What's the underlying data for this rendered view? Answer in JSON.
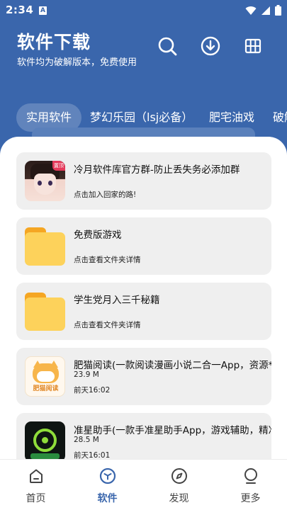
{
  "status": {
    "time": "2:34",
    "notif_letter": "A"
  },
  "header": {
    "title": "软件下载",
    "subtitle": "软件均为破解版本，免费使用",
    "icons": [
      "search-icon",
      "download-icon",
      "grid-icon"
    ]
  },
  "tabs": [
    {
      "label": "实用软件",
      "active": true
    },
    {
      "label": "梦幻乐园（lsj必备）",
      "active": false
    },
    {
      "label": "肥宅油戏",
      "active": false
    },
    {
      "label": "破解",
      "active": false
    }
  ],
  "cards": [
    {
      "title": "冷月软件库官方群-防止丢失务必添加群",
      "sub1": "",
      "sub2": "点击加入回家的路!",
      "badge": "置顶",
      "icon": "avatar"
    },
    {
      "title": "免费版游戏",
      "sub1": "",
      "sub2": "点击查看文件夹详情",
      "icon": "folder-icon"
    },
    {
      "title": "学生党月入三千秘籍",
      "sub1": "",
      "sub2": "点击查看文件夹详情",
      "icon": "folder-icon"
    },
    {
      "title": "肥猫阅读(一款阅读漫画小说二合一App，资源*",
      "sub1": "23.9 M",
      "sub2": "前天16:02",
      "icon_text": "肥猫阅读",
      "icon": "cat-app-icon"
    },
    {
      "title": "准星助手(一款手准星助手App，游戏辅助，精准",
      "sub1": "28.5 M",
      "sub2": "前天16:01",
      "icon": "crosshair-app-icon"
    }
  ],
  "nav": [
    {
      "label": "首页",
      "icon": "home-icon",
      "active": false
    },
    {
      "label": "软件",
      "icon": "box-icon",
      "active": true
    },
    {
      "label": "发现",
      "icon": "compass-icon",
      "active": false
    },
    {
      "label": "更多",
      "icon": "user-icon",
      "active": false
    }
  ],
  "colors": {
    "primary": "#3a66ac",
    "card_bg": "#efefef",
    "folder": "#fdd25b"
  }
}
